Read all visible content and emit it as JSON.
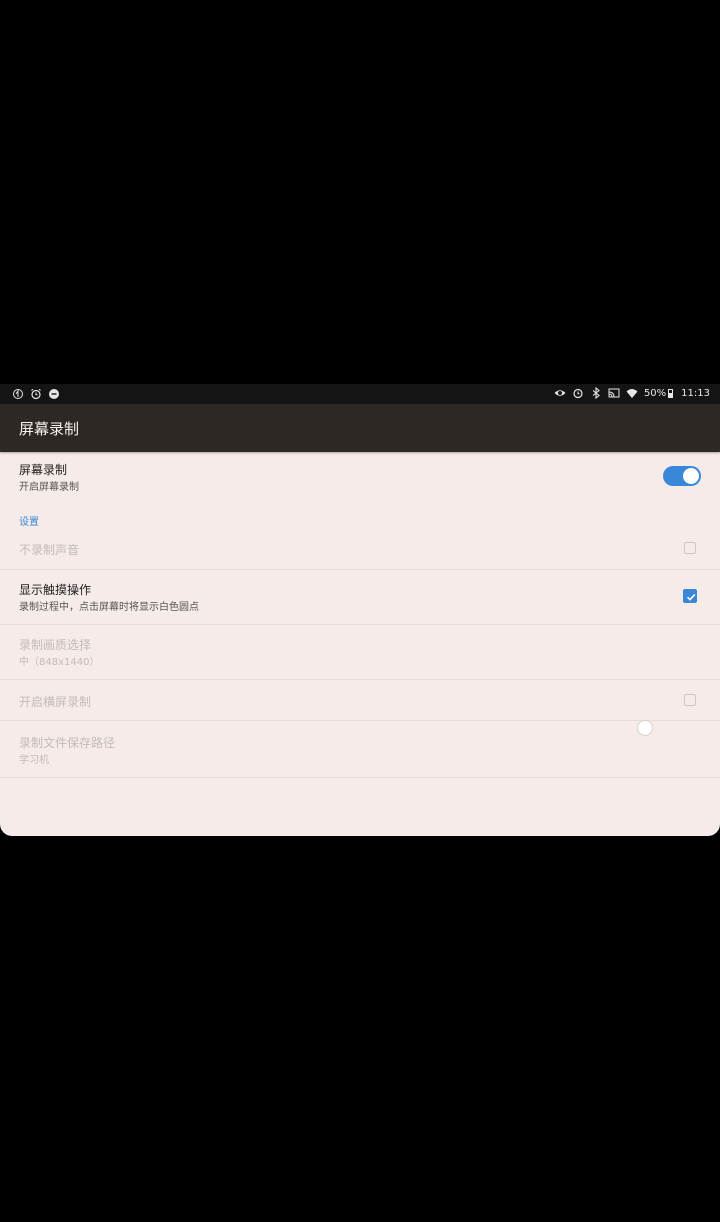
{
  "status_bar": {
    "left_icons": [
      "sync-icon",
      "alarm-icon",
      "notification-dot-icon"
    ],
    "right_icons": [
      "eye-icon",
      "alarm-icon",
      "bluetooth-icon",
      "cast-icon",
      "wifi-icon"
    ],
    "battery": "50%",
    "battery_level": 0.5,
    "time": "11:13"
  },
  "app_bar": {
    "title": "屏幕录制"
  },
  "master": {
    "title": "屏幕录制",
    "summary": "开启屏幕录制",
    "enabled": true
  },
  "section": {
    "header": "设置"
  },
  "settings": {
    "no_audio": {
      "title": "不录制声音",
      "checked": false
    },
    "show_touches": {
      "title": "显示触摸操作",
      "summary": "录制过程中，点击屏幕时将显示白色圆点",
      "checked": true
    },
    "resolution": {
      "title": "录制画质选择",
      "summary": "中（848x1440）"
    },
    "landscape": {
      "title": "开启横屏录制",
      "checked": false
    },
    "save_path": {
      "title": "录制文件保存路径",
      "summary": "学习机"
    }
  },
  "colors": {
    "accent": "#3a87d9",
    "background": "#f5ebe8",
    "app_bar": "#2e2824"
  }
}
